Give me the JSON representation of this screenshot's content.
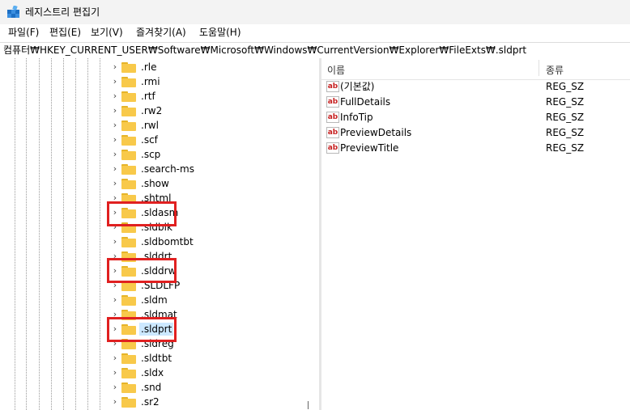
{
  "window": {
    "title": "레지스트리 편집기",
    "icon": "registry-editor-icon"
  },
  "menu": [
    {
      "label": "파일(F)"
    },
    {
      "label": "편집(E)"
    },
    {
      "label": "보기(V)"
    },
    {
      "label": "즐겨찾기(A)"
    },
    {
      "label": "도움말(H)"
    }
  ],
  "address": {
    "path": "컴퓨터₩HKEY_CURRENT_USER₩Software₩Microsoft₩Windows₩CurrentVersion₩Explorer₩FileExts₩.sldprt"
  },
  "tree": {
    "items": [
      {
        "label": ".rle",
        "selected": false
      },
      {
        "label": ".rmi",
        "selected": false
      },
      {
        "label": ".rtf",
        "selected": false
      },
      {
        "label": ".rw2",
        "selected": false
      },
      {
        "label": ".rwl",
        "selected": false
      },
      {
        "label": ".scf",
        "selected": false
      },
      {
        "label": ".scp",
        "selected": false
      },
      {
        "label": ".search-ms",
        "selected": false
      },
      {
        "label": ".show",
        "selected": false
      },
      {
        "label": ".shtml",
        "selected": false
      },
      {
        "label": ".sldasm",
        "selected": false,
        "highlighted": true
      },
      {
        "label": ".sldblk",
        "selected": false
      },
      {
        "label": ".sldbomtbt",
        "selected": false
      },
      {
        "label": ".slddrt",
        "selected": false
      },
      {
        "label": ".slddrw",
        "selected": false,
        "highlighted": true
      },
      {
        "label": ".SLDLFP",
        "selected": false
      },
      {
        "label": ".sldm",
        "selected": false
      },
      {
        "label": ".sldmat",
        "selected": false
      },
      {
        "label": ".sldprt",
        "selected": true,
        "highlighted": true
      },
      {
        "label": ".sldreg",
        "selected": false
      },
      {
        "label": ".sldtbt",
        "selected": false
      },
      {
        "label": ".sldx",
        "selected": false
      },
      {
        "label": ".snd",
        "selected": false
      },
      {
        "label": ".sr2",
        "selected": false
      }
    ],
    "highlight_color": "#e02020",
    "selection_color": "#cce8ff",
    "folder_color": "#f8c94a"
  },
  "values": {
    "columns": {
      "name": "이름",
      "type": "종류"
    },
    "rows": [
      {
        "name": "(기본값)",
        "type": "REG_SZ"
      },
      {
        "name": "FullDetails",
        "type": "REG_SZ"
      },
      {
        "name": "InfoTip",
        "type": "REG_SZ"
      },
      {
        "name": "PreviewDetails",
        "type": "REG_SZ"
      },
      {
        "name": "PreviewTitle",
        "type": "REG_SZ"
      }
    ],
    "icon": "string-value-icon",
    "icon_glyph": "ab"
  }
}
